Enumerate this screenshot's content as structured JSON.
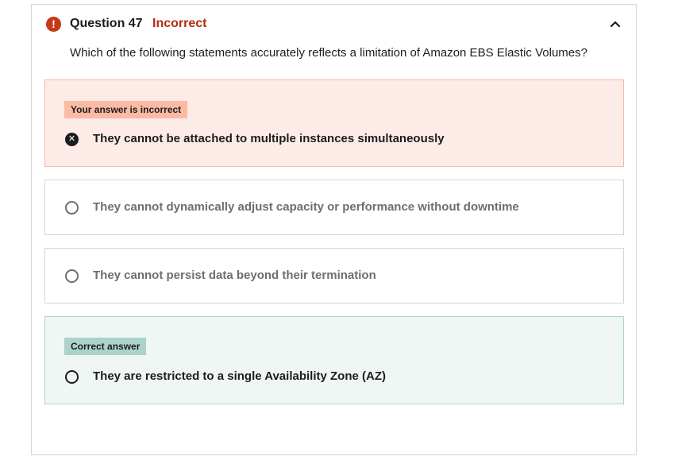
{
  "question": {
    "number_label": "Question 47",
    "status": "Incorrect",
    "prompt": "Which of the following statements accurately reflects a limitation of Amazon EBS Elastic Volumes?",
    "status_icon": "exclamation-icon",
    "collapse_icon": "chevron-up-icon"
  },
  "options": [
    {
      "badge": "Your answer is incorrect",
      "text": "They cannot be attached to multiple instances simultaneously",
      "state": "incorrect"
    },
    {
      "text": "They cannot dynamically adjust capacity or performance without downtime",
      "state": "neutral"
    },
    {
      "text": "They cannot persist data beyond their termination",
      "state": "neutral"
    },
    {
      "badge": "Correct answer",
      "text": "They are restricted to a single Availability Zone (AZ)",
      "state": "correct"
    }
  ],
  "colors": {
    "incorrect_accent": "#b32d0f",
    "incorrect_bg": "#fdebe7",
    "correct_bg": "#f0f6f4",
    "correct_badge": "#acd2cc"
  }
}
